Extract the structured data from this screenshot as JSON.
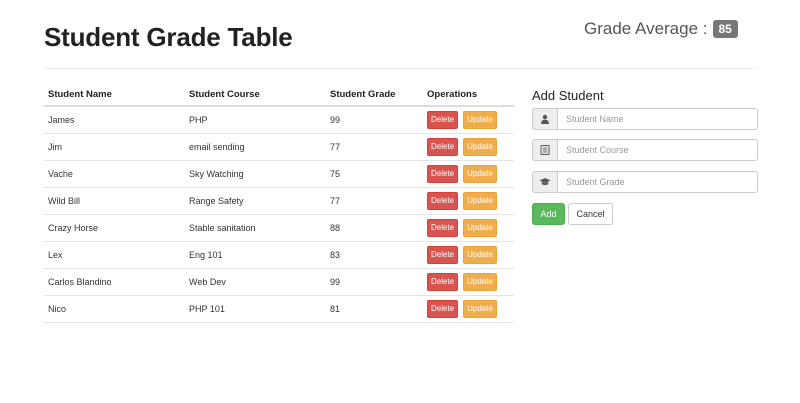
{
  "header": {
    "title": "Student Grade Table",
    "average_label": "Grade Average :",
    "average_value": "85"
  },
  "table": {
    "columns": [
      "Student Name",
      "Student Course",
      "Student Grade",
      "Operations"
    ],
    "rows": [
      {
        "name": "James",
        "course": "PHP",
        "grade": "99"
      },
      {
        "name": "Jim",
        "course": "email sending",
        "grade": "77"
      },
      {
        "name": "Vache",
        "course": "Sky Watching",
        "grade": "75"
      },
      {
        "name": "Wild Bill",
        "course": "Range Safety",
        "grade": "77"
      },
      {
        "name": "Crazy Horse",
        "course": "Stable sanitation",
        "grade": "88"
      },
      {
        "name": "Lex",
        "course": "Eng 101",
        "grade": "83"
      },
      {
        "name": "Carlos Blandino",
        "course": "Web Dev",
        "grade": "99"
      },
      {
        "name": "Nico",
        "course": "PHP 101",
        "grade": "81"
      }
    ],
    "delete_label": "Delete",
    "update_label": "Update"
  },
  "form": {
    "title": "Add Student",
    "name_placeholder": "Student Name",
    "course_placeholder": "Student Course",
    "grade_placeholder": "Student Grade",
    "name_value": "",
    "course_value": "",
    "grade_value": "",
    "add_label": "Add",
    "cancel_label": "Cancel",
    "icons": [
      "user-icon",
      "list-icon",
      "graduation-cap-icon"
    ]
  },
  "colors": {
    "delete": "#d9534f",
    "update": "#f0ad4e",
    "add": "#5cb85c",
    "badge": "#777777"
  }
}
